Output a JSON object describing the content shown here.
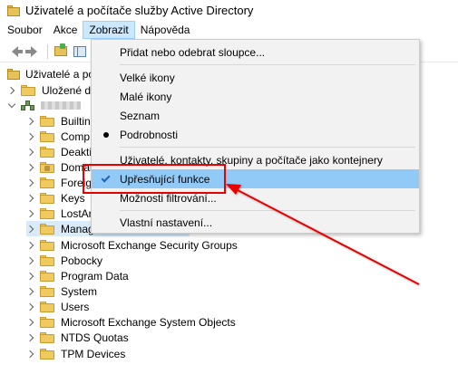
{
  "window": {
    "title": "Uživatelé a počítače služby Active Directory"
  },
  "menubar": {
    "items": [
      "Soubor",
      "Akce",
      "Zobrazit",
      "Nápověda"
    ]
  },
  "tree": {
    "root_label": "Uživatelé a po",
    "saved_queries_label": "Uložené d",
    "items": [
      "Builtin",
      "Comp",
      "Deakti",
      "Domai",
      "Foreig",
      "Keys",
      "LostAr",
      "Manag",
      "Microsoft Exchange Security Groups",
      "Pobocky",
      "Program Data",
      "System",
      "Users",
      "Microsoft Exchange System Objects",
      "NTDS Quotas",
      "TPM Devices"
    ]
  },
  "view_menu": {
    "add_remove_columns": "Přidat nebo odebrat sloupce...",
    "large_icons": "Velké ikony",
    "small_icons": "Malé ikony",
    "list": "Seznam",
    "details": "Podrobnosti",
    "users_as_containers": "Uživatelé, kontakty, skupiny a počítače jako kontejnery",
    "advanced_features": "Upřesňující funkce",
    "filter_options": "Možnosti filtrování...",
    "customize": "Vlastní nastavení..."
  },
  "colors": {
    "highlight": "#91c9f7",
    "annotation": "#e60000",
    "menu_bg": "#f2f2f2"
  }
}
